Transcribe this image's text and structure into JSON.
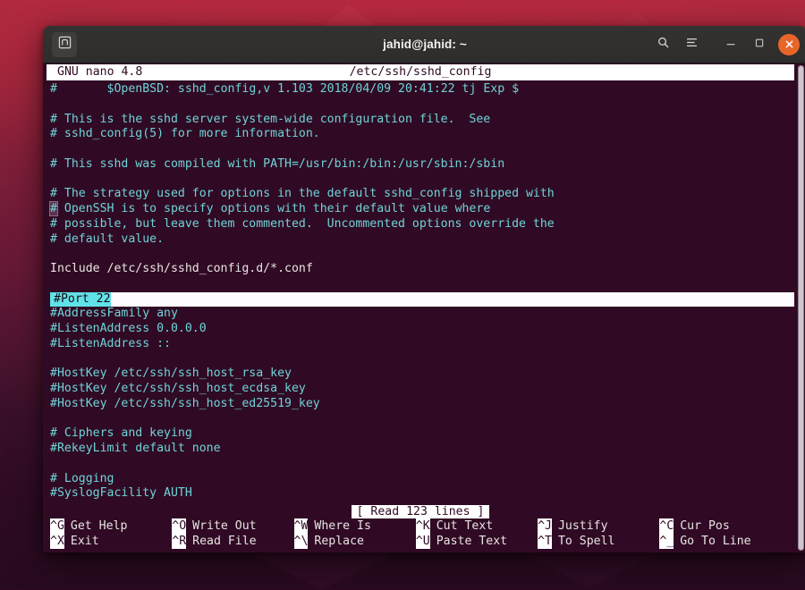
{
  "desktop": {
    "wallpaper_top_color": "#b02a3e",
    "wallpaper_bottom_color": "#280a1e"
  },
  "window": {
    "title": "jahid@jahid: ~",
    "titlebar_color": "#312f2e",
    "close_button_color": "#e8652a",
    "buttons": {
      "new_terminal": "new-terminal-icon",
      "search": "search-icon",
      "menu": "hamburger-menu-icon",
      "minimize": "minimize-icon",
      "maximize": "maximize-icon",
      "close": "close-icon"
    }
  },
  "terminal": {
    "background_color": "#300a24",
    "foreground_color": "#e8e4e2",
    "comment_color": "#6fd3d8",
    "highlight_color": "#5fe3e8"
  },
  "nano": {
    "version_label": "GNU nano 4.8",
    "filename": "/etc/ssh/sshd_config",
    "status_message": "[ Read 123 lines ]",
    "lines": [
      {
        "text": "#\t$OpenBSD: sshd_config,v 1.103 2018/04/09 20:41:22 tj Exp $",
        "style": "comment"
      },
      {
        "text": "",
        "style": "blank"
      },
      {
        "text": "# This is the sshd server system-wide configuration file.  See",
        "style": "comment"
      },
      {
        "text": "# sshd_config(5) for more information.",
        "style": "comment"
      },
      {
        "text": "",
        "style": "blank"
      },
      {
        "text": "# This sshd was compiled with PATH=/usr/bin:/bin:/usr/sbin:/sbin",
        "style": "comment"
      },
      {
        "text": "",
        "style": "blank"
      },
      {
        "text": "# The strategy used for options in the default sshd_config shipped with",
        "style": "comment"
      },
      {
        "text": "# OpenSSH is to specify options with their default value where",
        "style": "comment-cursor"
      },
      {
        "text": "# possible, but leave them commented.  Uncommented options override the",
        "style": "comment"
      },
      {
        "text": "# default value.",
        "style": "comment"
      },
      {
        "text": "",
        "style": "blank"
      },
      {
        "text": "Include /etc/ssh/sshd_config.d/*.conf",
        "style": "plain"
      },
      {
        "text": "",
        "style": "blank"
      },
      {
        "text": "#Port 22",
        "style": "selected"
      },
      {
        "text": "#AddressFamily any",
        "style": "comment"
      },
      {
        "text": "#ListenAddress 0.0.0.0",
        "style": "comment"
      },
      {
        "text": "#ListenAddress ::",
        "style": "comment"
      },
      {
        "text": "",
        "style": "blank"
      },
      {
        "text": "#HostKey /etc/ssh/ssh_host_rsa_key",
        "style": "comment"
      },
      {
        "text": "#HostKey /etc/ssh/ssh_host_ecdsa_key",
        "style": "comment"
      },
      {
        "text": "#HostKey /etc/ssh/ssh_host_ed25519_key",
        "style": "comment"
      },
      {
        "text": "",
        "style": "blank"
      },
      {
        "text": "# Ciphers and keying",
        "style": "comment"
      },
      {
        "text": "#RekeyLimit default none",
        "style": "comment"
      },
      {
        "text": "",
        "style": "blank"
      },
      {
        "text": "# Logging",
        "style": "comment"
      },
      {
        "text": "#SyslogFacility AUTH",
        "style": "comment"
      }
    ],
    "shortcuts": [
      {
        "chord": "^G",
        "label": "Get Help"
      },
      {
        "chord": "^O",
        "label": "Write Out"
      },
      {
        "chord": "^W",
        "label": "Where Is"
      },
      {
        "chord": "^K",
        "label": "Cut Text"
      },
      {
        "chord": "^J",
        "label": "Justify"
      },
      {
        "chord": "^C",
        "label": "Cur Pos"
      },
      {
        "chord": "^X",
        "label": "Exit"
      },
      {
        "chord": "^R",
        "label": "Read File"
      },
      {
        "chord": "^\\",
        "label": "Replace"
      },
      {
        "chord": "^U",
        "label": "Paste Text"
      },
      {
        "chord": "^T",
        "label": "To Spell"
      },
      {
        "chord": "^_",
        "label": "Go To Line"
      }
    ]
  }
}
